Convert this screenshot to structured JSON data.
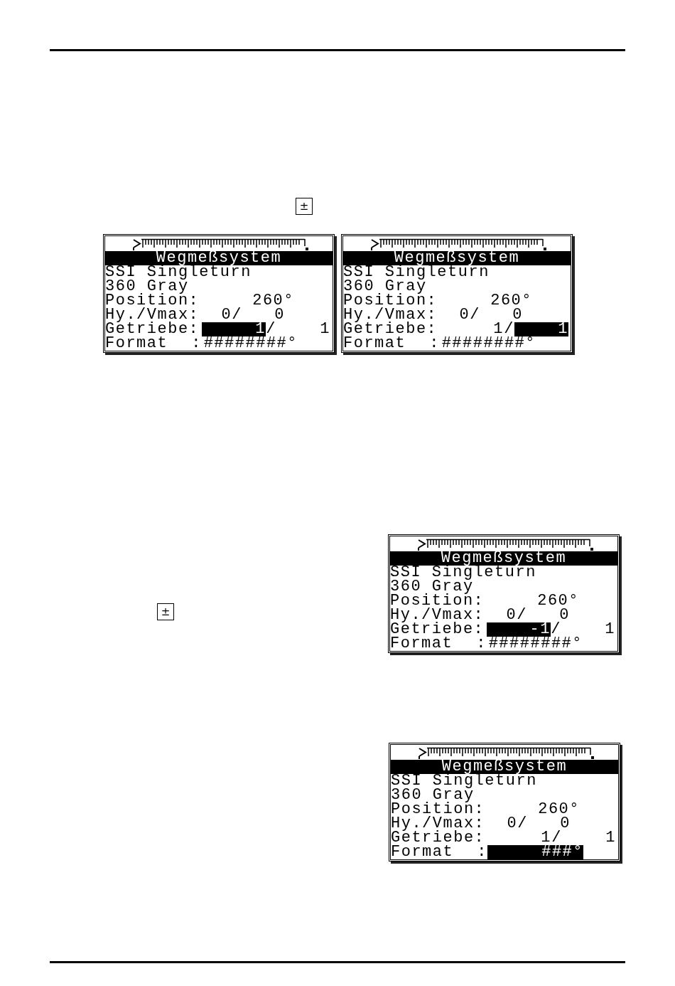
{
  "key_1": {
    "symbol": "±"
  },
  "screens_top": [
    {
      "title": "Wegmeßsystem",
      "lines": [
        "SSI Singleturn",
        "360 Gray"
      ],
      "position": {
        "label": "Position:",
        "value": "260°"
      },
      "hy_vmax": {
        "label": "Hy./Vmax:",
        "value_1": "0/",
        "value_2": "0"
      },
      "getriebe": {
        "label": "Getriebe:",
        "numerator": {
          "text": "1",
          "selected": true
        },
        "separator": "/",
        "denominator": {
          "text": "1",
          "selected": false
        }
      },
      "format": {
        "label": "Format",
        "colon": ":",
        "value": {
          "text": "########°",
          "selected": false
        }
      }
    },
    {
      "title": "Wegmeßsystem",
      "lines": [
        "SSI Singleturn",
        "360 Gray"
      ],
      "position": {
        "label": "Position:",
        "value": "260°"
      },
      "hy_vmax": {
        "label": "Hy./Vmax:",
        "value_1": "0/",
        "value_2": "0"
      },
      "getriebe": {
        "label": "Getriebe:",
        "numerator": {
          "text": "1",
          "selected": false
        },
        "separator": "/",
        "denominator": {
          "text": "1",
          "selected": true
        }
      },
      "format": {
        "label": "Format",
        "colon": ":",
        "value": {
          "text": "########°",
          "selected": false
        }
      }
    }
  ],
  "step_2": {
    "key": {
      "symbol": "±"
    },
    "screen": {
      "title": "Wegmeßsystem",
      "lines": [
        "SSI Singleturn",
        "360 Gray"
      ],
      "position": {
        "label": "Position:",
        "value": "260°"
      },
      "hy_vmax": {
        "label": "Hy./Vmax:",
        "value_1": "0/",
        "value_2": "0"
      },
      "getriebe": {
        "label": "Getriebe:",
        "numerator": {
          "text": "-1",
          "selected": true
        },
        "separator": "/",
        "denominator": {
          "text": "1",
          "selected": false
        }
      },
      "format": {
        "label": "Format",
        "colon": ":",
        "value": {
          "text": "########°",
          "selected": false
        }
      }
    }
  },
  "step_3": {
    "screen": {
      "title": "Wegmeßsystem",
      "lines": [
        "SSI Singleturn",
        "360 Gray"
      ],
      "position": {
        "label": "Position:",
        "value": "260°"
      },
      "hy_vmax": {
        "label": "Hy./Vmax:",
        "value_1": "0/",
        "value_2": "0"
      },
      "getriebe": {
        "label": "Getriebe:",
        "numerator": {
          "text": "1",
          "selected": false
        },
        "separator": "/",
        "denominator": {
          "text": "1",
          "selected": false
        }
      },
      "format": {
        "label": "Format",
        "colon": ":",
        "value": {
          "text": "###°",
          "selected": true
        }
      }
    }
  }
}
